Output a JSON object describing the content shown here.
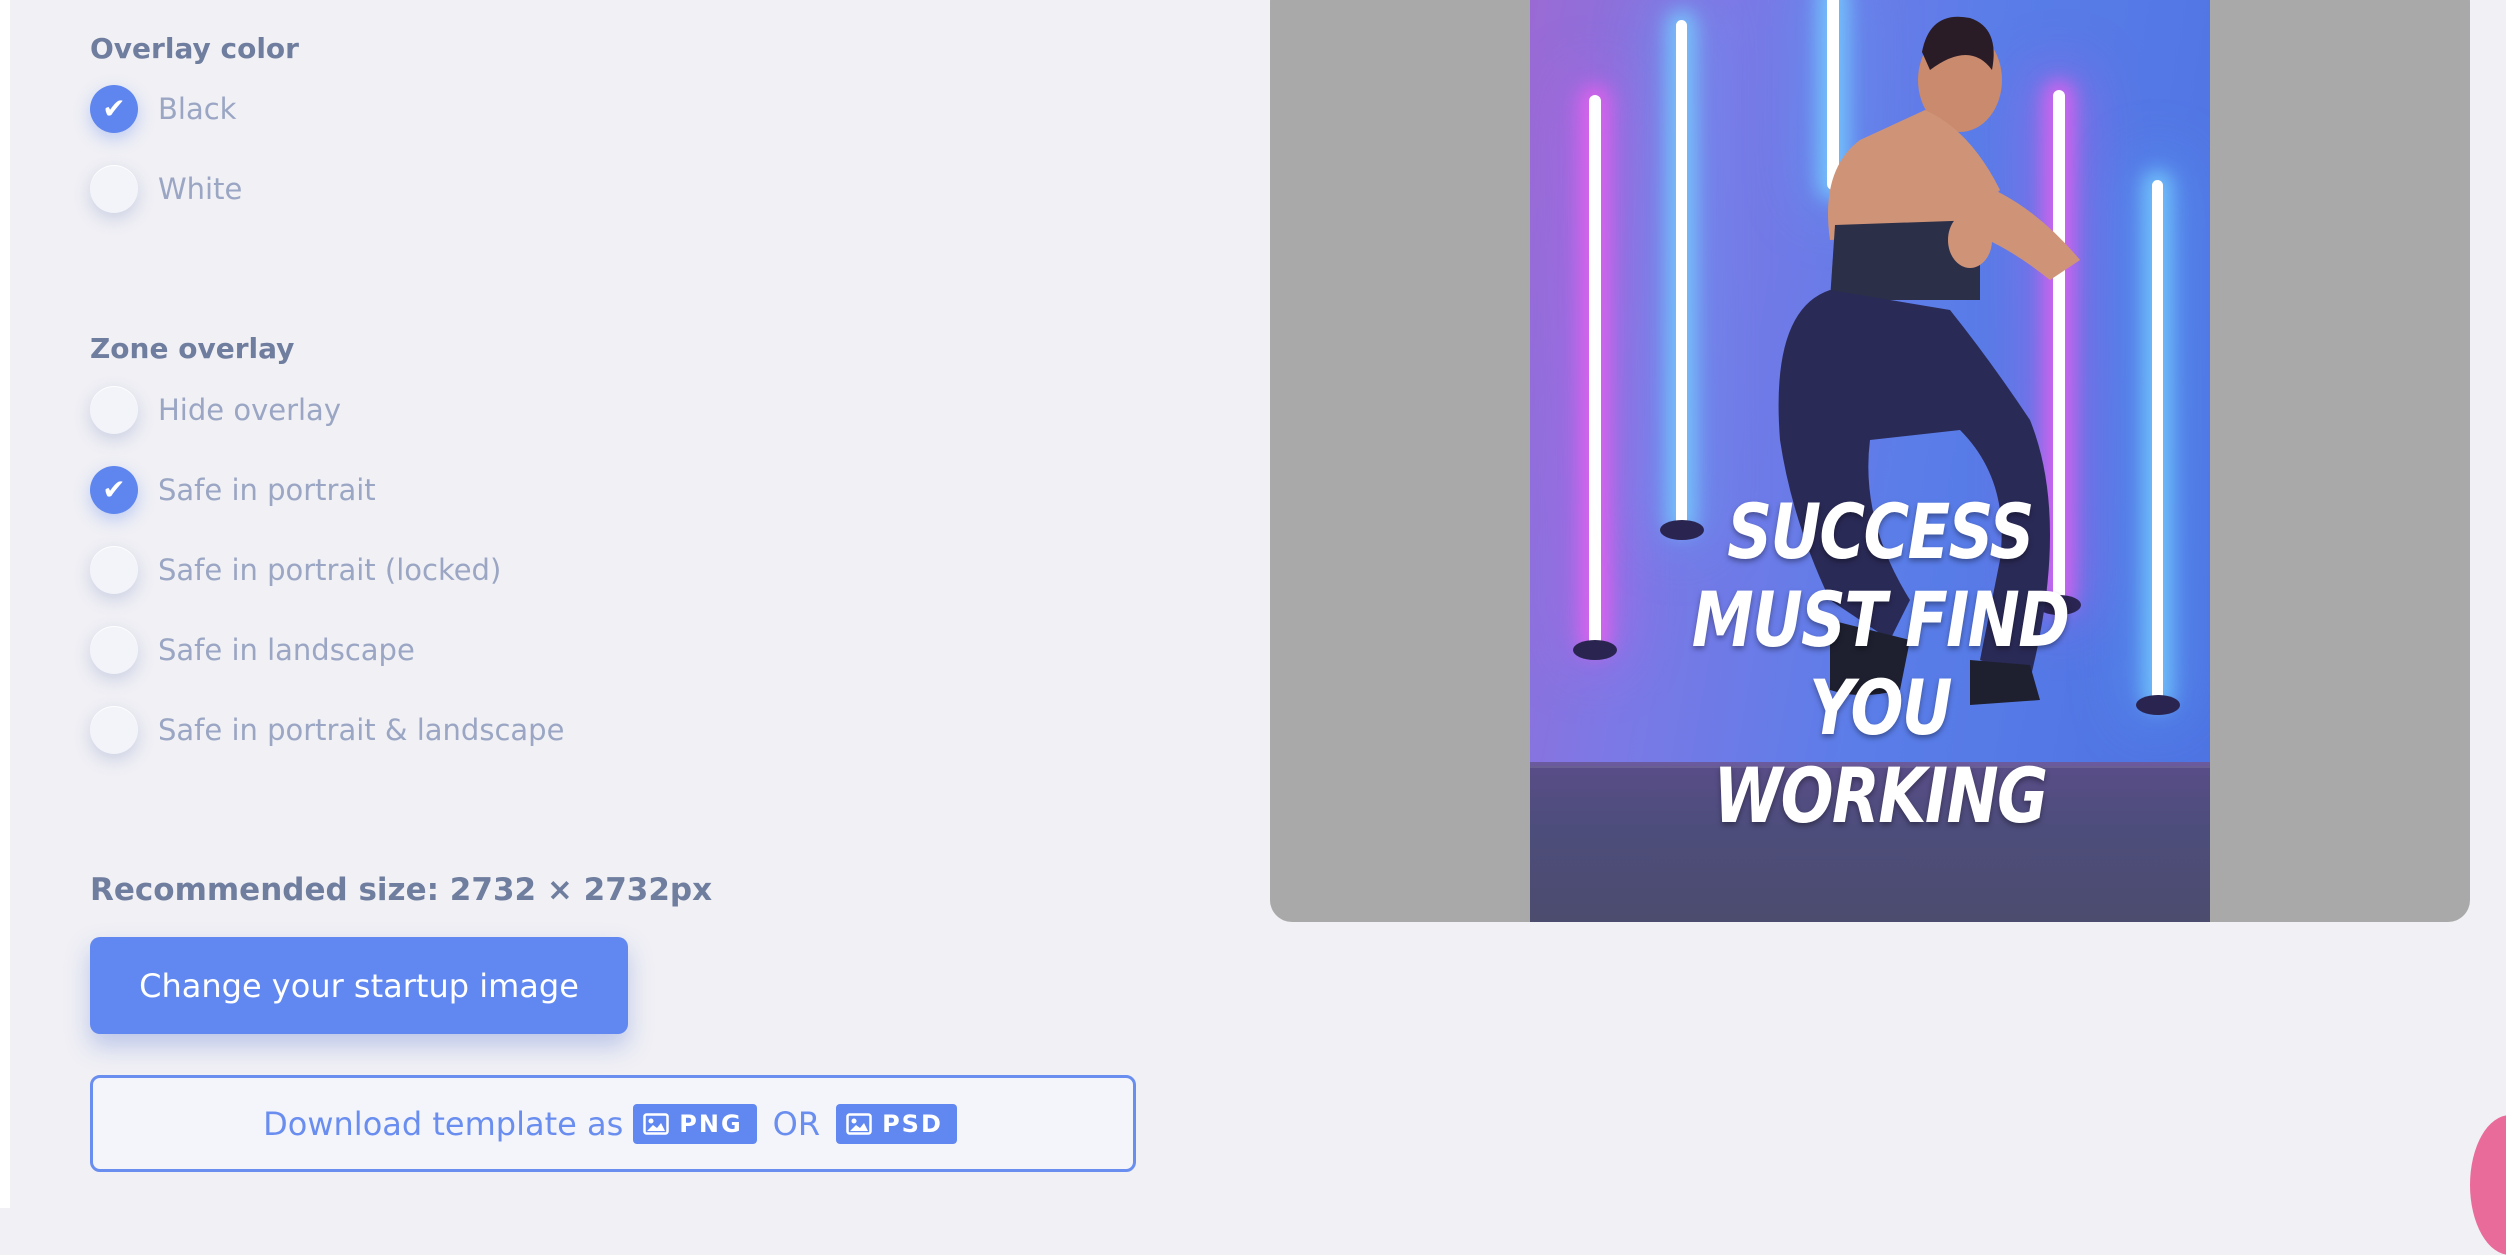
{
  "overlay_color": {
    "title": "Overlay color",
    "options": [
      {
        "label": "Black",
        "checked": true
      },
      {
        "label": "White",
        "checked": false
      }
    ]
  },
  "zone_overlay": {
    "title": "Zone overlay",
    "options": [
      {
        "label": "Hide overlay",
        "checked": false
      },
      {
        "label": "Safe in portrait",
        "checked": true
      },
      {
        "label": "Safe in portrait (locked)",
        "checked": false
      },
      {
        "label": "Safe in landscape",
        "checked": false
      },
      {
        "label": "Safe in portrait & landscape",
        "checked": false
      }
    ]
  },
  "check_glyph": "✔",
  "recommended_size": "Recommended size: 2732 × 2732px",
  "change_button": "Change your startup image",
  "download": {
    "prefix": "Download template as",
    "png": "PNG",
    "or": "OR",
    "psd": "PSD"
  },
  "preview": {
    "line1": "SUCCESS",
    "line2": "MUST FIND",
    "line3": "YOU WORKING"
  },
  "colors": {
    "accent": "#6188f1",
    "background": "#f0f0f5",
    "preview_panel": "#a9a9a9"
  }
}
